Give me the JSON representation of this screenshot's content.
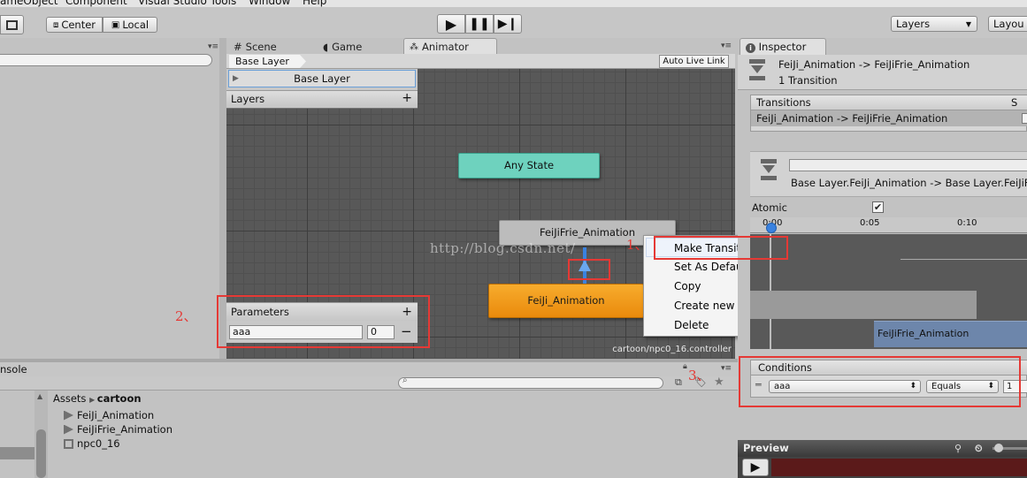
{
  "menubar": {
    "items": [
      "ameObject",
      "Component",
      "Visual Studio Tools",
      "Window",
      "Help"
    ]
  },
  "toolbar": {
    "center_label": "Center",
    "local_label": "Local",
    "layers_label": "Layers",
    "layout_label": "Layou"
  },
  "tabs": {
    "scene": "Scene",
    "game": "Game",
    "animator": "Animator",
    "inspector": "Inspector",
    "console": "nsole"
  },
  "animator": {
    "breadcrumb": "Base Layer",
    "auto_live_link": "Auto Live Link",
    "base_layer": "Base Layer",
    "layers_label": "Layers",
    "any_state": "Any State",
    "state_top": "FeiJiFrie_Animation",
    "state_bottom": "FeiJi_Animation",
    "watermark": "http://blog.csdn.net/",
    "footer_path": "cartoon/npc0_16.controller",
    "parameters": {
      "title": "Parameters",
      "name": "aaa",
      "value": "0"
    }
  },
  "context_menu": {
    "items": [
      "Make Transition",
      "Set As Default",
      "Copy",
      "Create new BlendTree in State",
      "Delete"
    ]
  },
  "annotations": {
    "one": "1、",
    "two": "2、",
    "three": "3、"
  },
  "inspector": {
    "title": "FeiJi_Animation -> FeiJiFrie_Animation",
    "subtitle": "1 Transition",
    "transitions_header": "Transitions",
    "transitions_s": "S",
    "transition_row": "FeiJi_Animation -> FeiJiFrie_Animation",
    "transition_detail": "Base Layer.FeiJi_Animation -> Base Layer.FeiJiFrie",
    "atomic_label": "Atomic",
    "atomic_checked": true,
    "timeline_ticks": [
      "0:00",
      "0:05",
      "0:10"
    ],
    "timeline_clip": "FeiJiFrie_Animation",
    "conditions_header": "Conditions",
    "condition": {
      "parameter": "aaa",
      "mode": "Equals",
      "value": "1"
    },
    "preview_label": "Preview"
  },
  "project": {
    "breadcrumb_root": "Assets",
    "breadcrumb_current": "cartoon",
    "files": [
      "FeiJi_Animation",
      "FeiJiFrie_Animation",
      "npc0_16"
    ]
  },
  "colors": {
    "any_state": "#6ed2be",
    "state_default": "#f59a1b",
    "grid_bg": "#5a5a5a",
    "highlight_red": "#e53935",
    "selection_blue": "#3a82e0"
  }
}
